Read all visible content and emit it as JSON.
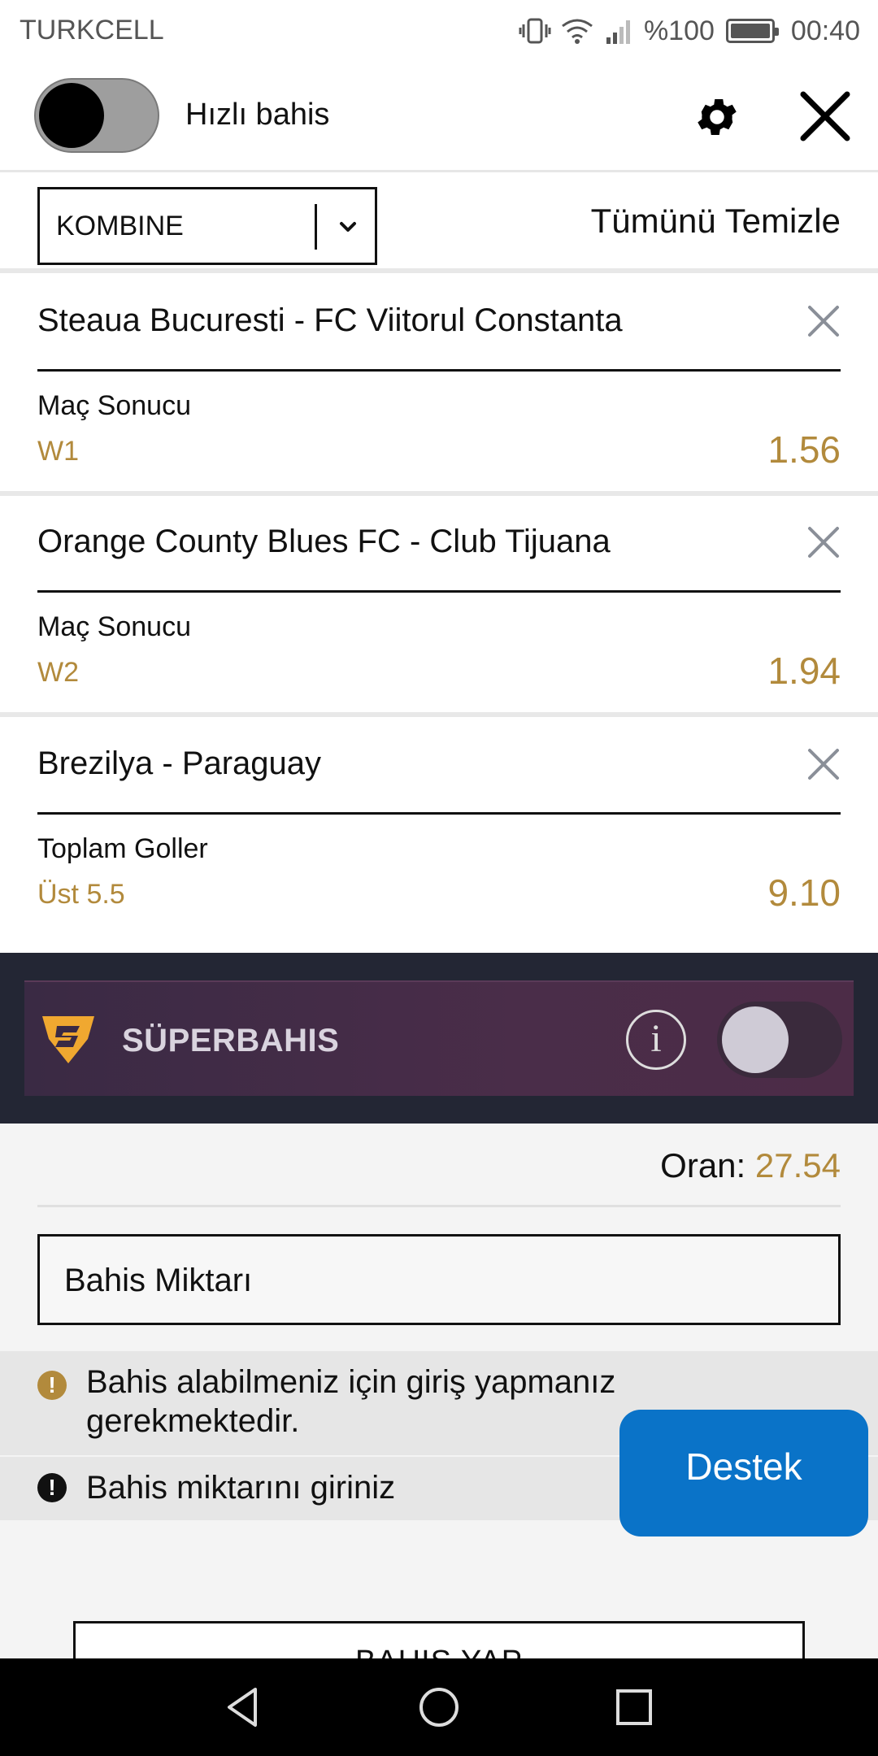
{
  "status_bar": {
    "carrier": "TURKCELL",
    "battery": "%100",
    "time": "00:40"
  },
  "top_bar": {
    "quick_bet_label": "Hızlı bahis",
    "quick_bet_enabled": false
  },
  "betslip": {
    "type_selected": "KOMBINE",
    "clear_all_label": "Tümünü Temizle"
  },
  "bets": [
    {
      "match": "Steaua Bucuresti - FC Viitorul Constanta",
      "market": "Maç Sonucu",
      "selection": "W1",
      "odds": "1.56"
    },
    {
      "match": "Orange County Blues FC - Club Tijuana",
      "market": "Maç Sonucu",
      "selection": "W2",
      "odds": "1.94"
    },
    {
      "match": "Brezilya - Paraguay",
      "market": "Toplam Goller",
      "selection": "Üst 5.5",
      "odds": "9.10"
    }
  ],
  "superbahis": {
    "label": "SÜPERBAHIS",
    "info_glyph": "i",
    "enabled": false
  },
  "summary": {
    "odds_label": "Oran:",
    "odds_value": "27.54",
    "stake_placeholder": "Bahis Miktarı"
  },
  "messages": {
    "login_required": "Bahis alabilmeniz için giriş yapmanız gerekmektedir.",
    "enter_stake": "Bahis miktarını giriniz"
  },
  "support_label": "Destek",
  "place_bet_label": "BAHIS YAP",
  "colors": {
    "odds_gold": "#b28a3c",
    "support_blue": "#0a73c8",
    "superbahis_bg": "#232634"
  }
}
